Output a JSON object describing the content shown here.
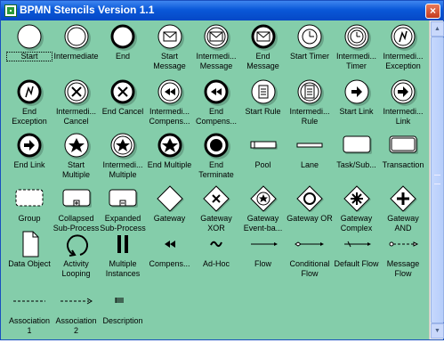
{
  "window": {
    "title": "BPMN Stencils Version 1.1",
    "close_symbol": "×"
  },
  "stencils": [
    {
      "label": "Start",
      "icon": "start-event-icon"
    },
    {
      "label": "Intermediate",
      "icon": "intermediate-event-icon"
    },
    {
      "label": "End",
      "icon": "end-event-icon"
    },
    {
      "label": "Start Message",
      "icon": "start-message-icon"
    },
    {
      "label": "Intermedi... Message",
      "icon": "intermediate-message-icon"
    },
    {
      "label": "End Message",
      "icon": "end-message-icon"
    },
    {
      "label": "Start Timer",
      "icon": "start-timer-icon"
    },
    {
      "label": "Intermedi... Timer",
      "icon": "intermediate-timer-icon"
    },
    {
      "label": "Intermedi... Exception",
      "icon": "intermediate-exception-icon"
    },
    {
      "label": "End Exception",
      "icon": "end-exception-icon"
    },
    {
      "label": "Intermedi... Cancel",
      "icon": "intermediate-cancel-icon"
    },
    {
      "label": "End Cancel",
      "icon": "end-cancel-icon"
    },
    {
      "label": "Intermedi... Compens...",
      "icon": "intermediate-compensation-icon"
    },
    {
      "label": "End Compens...",
      "icon": "end-compensation-icon"
    },
    {
      "label": "Start Rule",
      "icon": "start-rule-icon"
    },
    {
      "label": "Intermedi... Rule",
      "icon": "intermediate-rule-icon"
    },
    {
      "label": "Start Link",
      "icon": "start-link-icon"
    },
    {
      "label": "Intermedi... Link",
      "icon": "intermediate-link-icon"
    },
    {
      "label": "End Link",
      "icon": "end-link-icon"
    },
    {
      "label": "Start Multiple",
      "icon": "start-multiple-icon"
    },
    {
      "label": "Intermedi... Multiple",
      "icon": "intermediate-multiple-icon"
    },
    {
      "label": "End Multiple",
      "icon": "end-multiple-icon"
    },
    {
      "label": "End Terminate",
      "icon": "end-terminate-icon"
    },
    {
      "label": "Pool",
      "icon": "pool-icon"
    },
    {
      "label": "Lane",
      "icon": "lane-icon"
    },
    {
      "label": "Task/Sub...",
      "icon": "task-icon"
    },
    {
      "label": "Transaction",
      "icon": "transaction-icon"
    },
    {
      "label": "Group",
      "icon": "group-icon"
    },
    {
      "label": "Collapsed Sub-Process",
      "icon": "collapsed-subprocess-icon"
    },
    {
      "label": "Expanded Sub-Process",
      "icon": "expanded-subprocess-icon"
    },
    {
      "label": "Gateway",
      "icon": "gateway-icon"
    },
    {
      "label": "Gateway XOR",
      "icon": "gateway-xor-icon"
    },
    {
      "label": "Gateway Event-ba...",
      "icon": "gateway-event-based-icon"
    },
    {
      "label": "Gateway OR",
      "icon": "gateway-or-icon"
    },
    {
      "label": "Gateway Complex",
      "icon": "gateway-complex-icon"
    },
    {
      "label": "Gateway AND",
      "icon": "gateway-and-icon"
    },
    {
      "label": "Data Object",
      "icon": "data-object-icon"
    },
    {
      "label": "Activity Looping",
      "icon": "activity-looping-icon"
    },
    {
      "label": "Multiple Instances",
      "icon": "multiple-instances-icon"
    },
    {
      "label": "Compens...",
      "icon": "compensation-icon"
    },
    {
      "label": "Ad-Hoc",
      "icon": "ad-hoc-icon"
    },
    {
      "label": "Flow",
      "icon": "flow-icon"
    },
    {
      "label": "Conditional Flow",
      "icon": "conditional-flow-icon"
    },
    {
      "label": "Default Flow",
      "icon": "default-flow-icon"
    },
    {
      "label": "Message Flow",
      "icon": "message-flow-icon"
    },
    {
      "label": "Association 1",
      "icon": "association-1-icon"
    },
    {
      "label": "Association 2",
      "icon": "association-2-icon"
    },
    {
      "label": "Description",
      "icon": "description-icon"
    }
  ]
}
